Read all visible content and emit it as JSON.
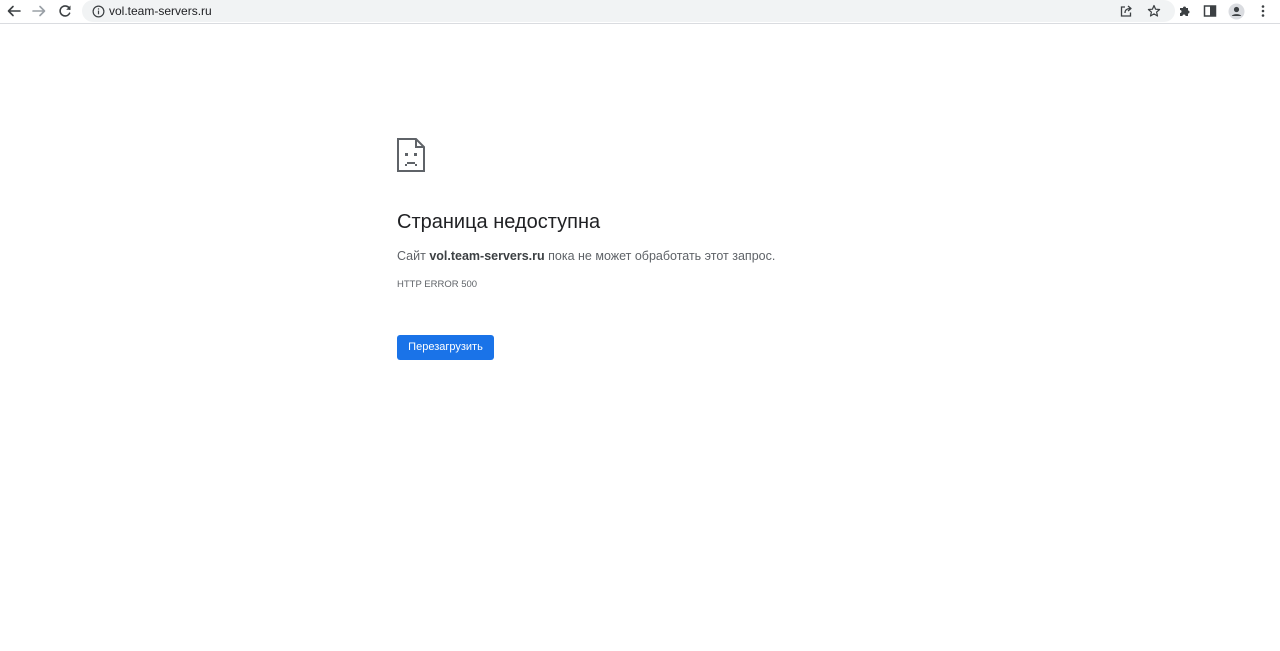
{
  "browser": {
    "toolbar": {
      "back_icon": "arrow-left-icon",
      "forward_icon": "arrow-right-icon",
      "reload_icon": "reload-icon",
      "share_icon": "share-icon",
      "bookmark_icon": "star-icon",
      "extensions_icon": "puzzle-icon",
      "side_panel_icon": "side-panel-icon",
      "profile_icon": "profile-icon",
      "menu_icon": "kebab-menu-icon"
    },
    "omnibox": {
      "site_info_icon": "info-icon",
      "url": "vol.team-servers.ru"
    }
  },
  "error_page": {
    "icon": "sad-document-icon",
    "title": "Страница недоступна",
    "description": {
      "prefix": "Сайт ",
      "site": "vol.team-servers.ru",
      "suffix": " пока не может обработать этот запрос."
    },
    "error_code": "HTTP ERROR 500",
    "reload_button_label": "Перезагрузить"
  },
  "colors": {
    "accent": "#1a73e8",
    "text_primary": "#202124",
    "text_secondary": "#5f6368",
    "omnibox_bg": "#f1f3f4"
  }
}
